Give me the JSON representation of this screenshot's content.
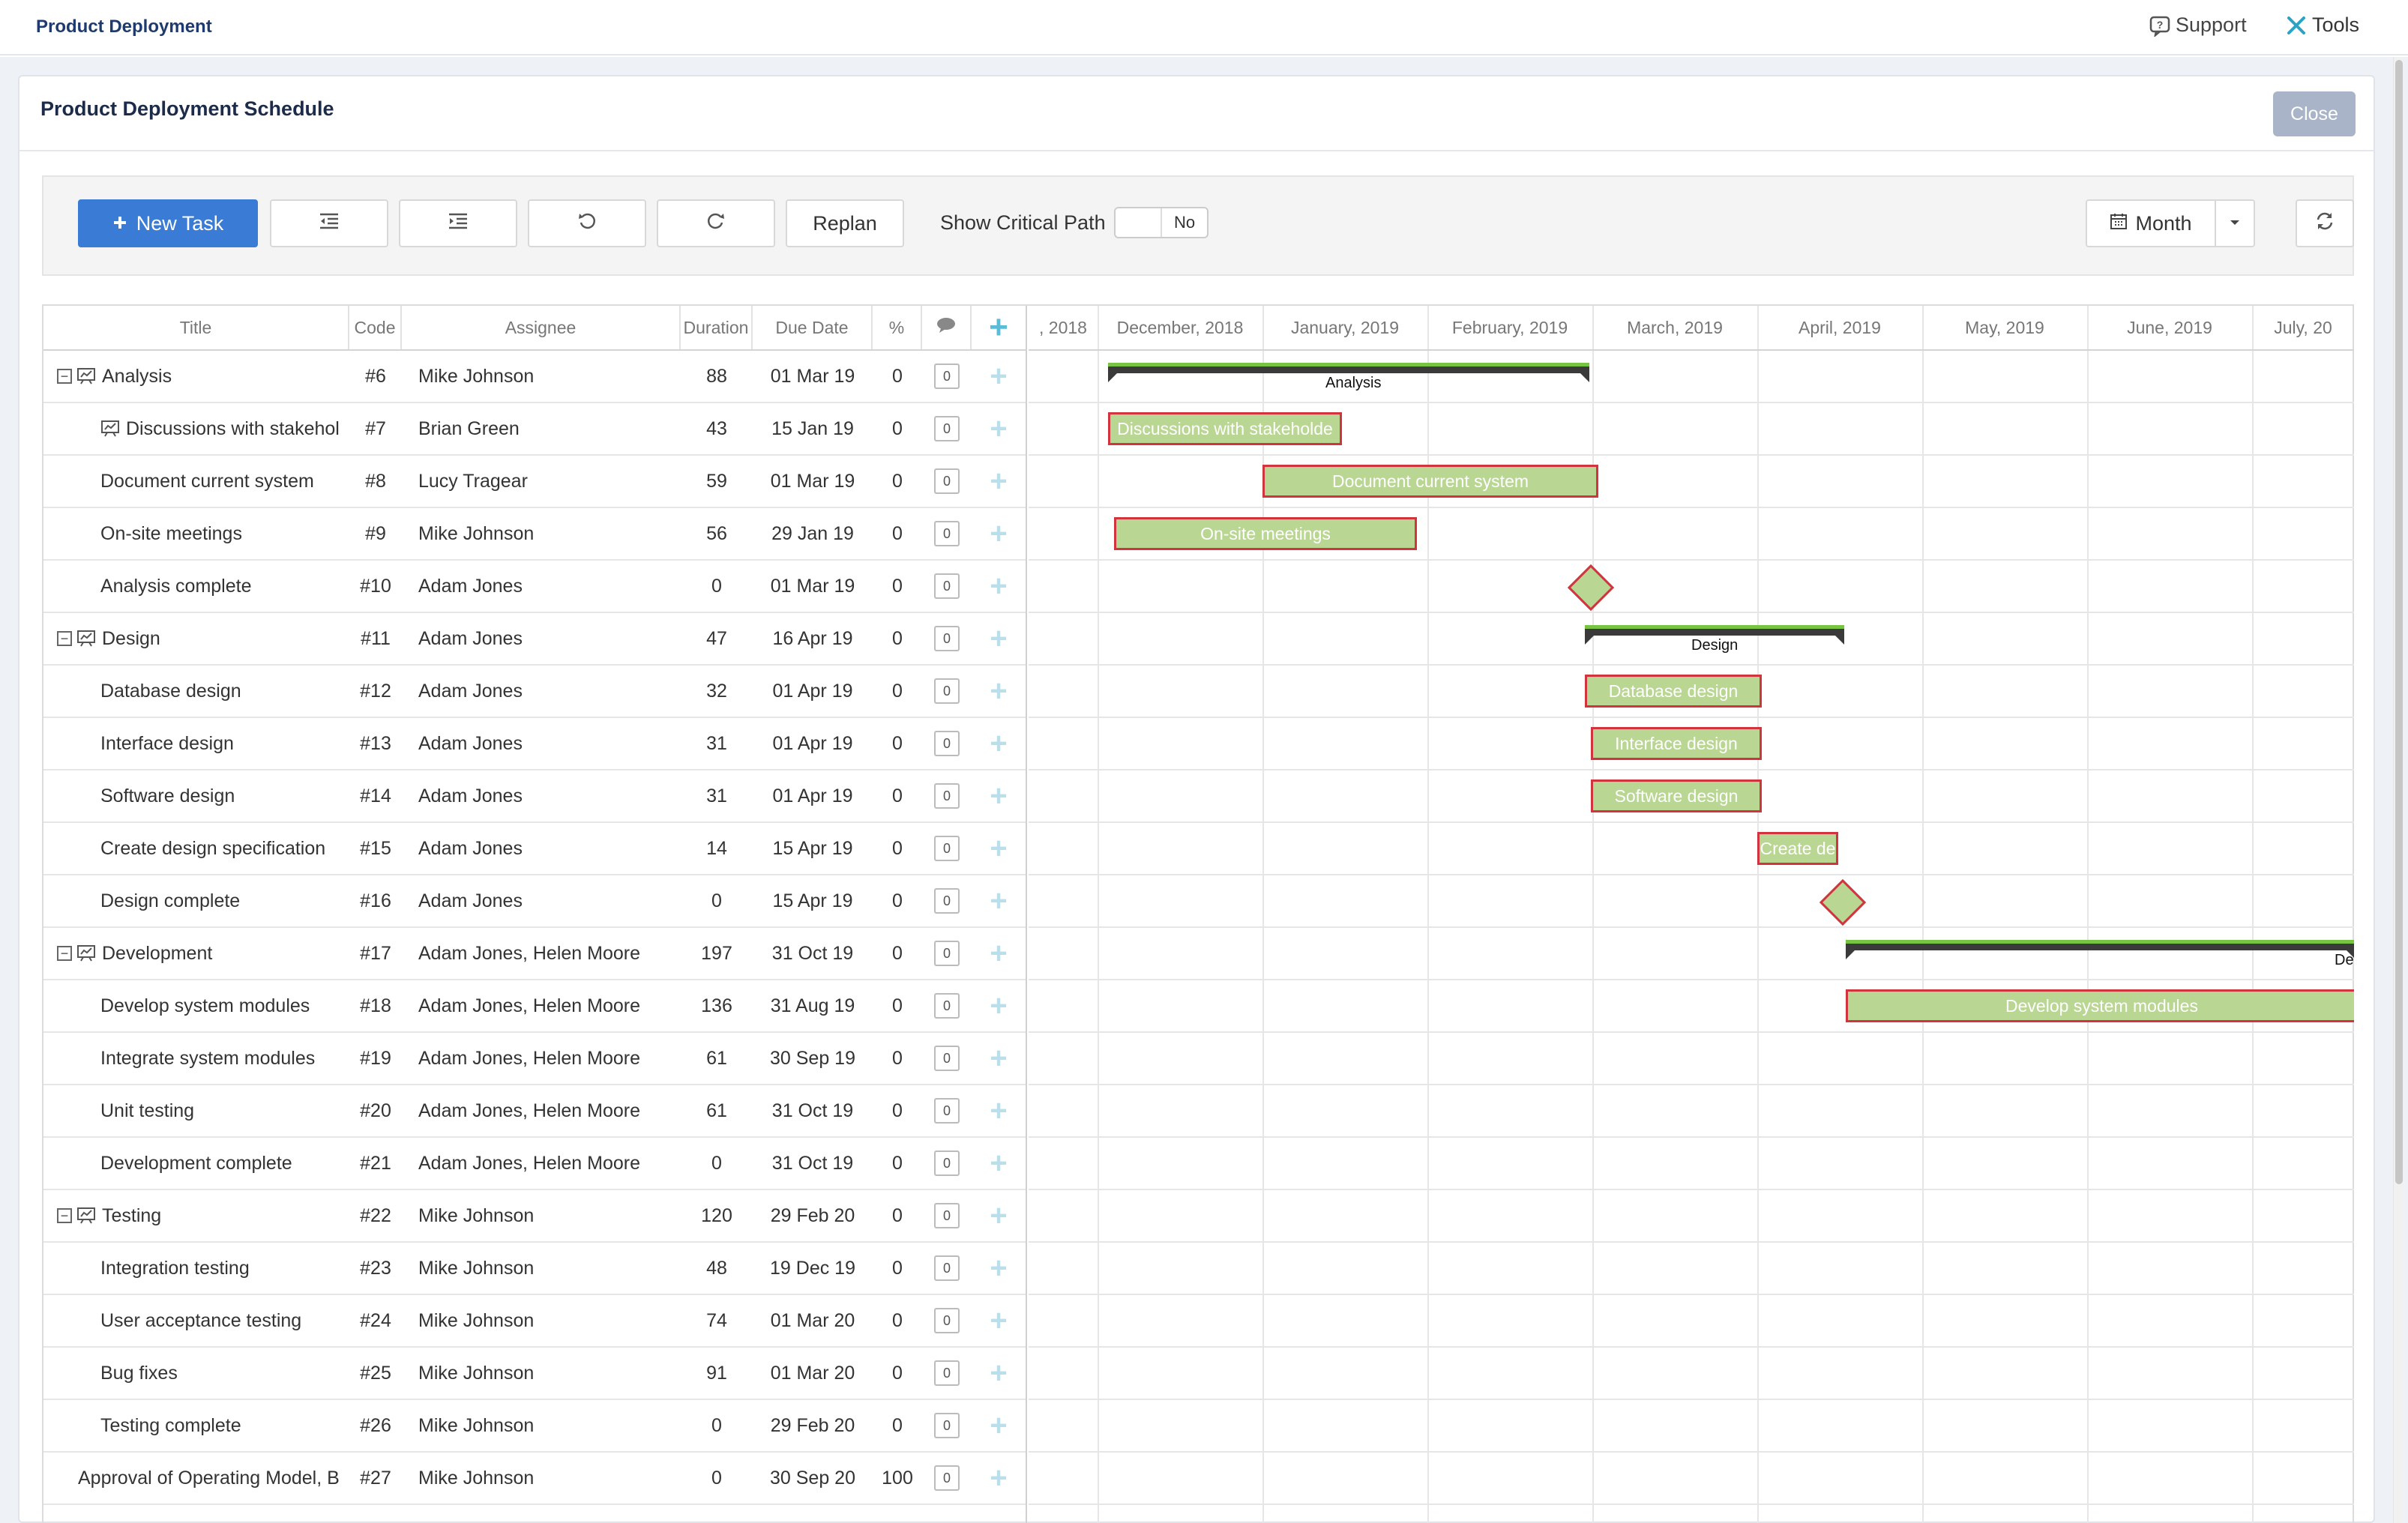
{
  "topbar": {
    "app_title": "Product Deployment",
    "support": "Support",
    "tools": "Tools"
  },
  "modal": {
    "title": "Product Deployment Schedule",
    "close": "Close"
  },
  "toolbar": {
    "new_task": "New Task",
    "replan": "Replan",
    "critical_path_label": "Show Critical Path",
    "critical_path_value": "No",
    "view_mode": "Month"
  },
  "columns": {
    "title": "Title",
    "code": "Code",
    "assignee": "Assignee",
    "duration": "Duration",
    "due_date": "Due Date",
    "percent": "%"
  },
  "timeline": {
    "months": [
      ", 2018",
      "December, 2018",
      "January, 2019",
      "February, 2019",
      "March, 2019",
      "April, 2019",
      "May, 2019",
      "June, 2019",
      "July, 20"
    ]
  },
  "tasks": [
    {
      "title": "Analysis",
      "code": "#6",
      "assignee": "Mike Johnson",
      "duration": "88",
      "due": "01 Mar 19",
      "pct": "0",
      "comments": "0",
      "group": true
    },
    {
      "title": "Discussions with stakehol",
      "code": "#7",
      "assignee": "Brian Green",
      "duration": "43",
      "due": "15 Jan 19",
      "pct": "0",
      "comments": "0"
    },
    {
      "title": "Document current system",
      "code": "#8",
      "assignee": "Lucy Tragear",
      "duration": "59",
      "due": "01 Mar 19",
      "pct": "0",
      "comments": "0"
    },
    {
      "title": "On-site meetings",
      "code": "#9",
      "assignee": "Mike Johnson",
      "duration": "56",
      "due": "29 Jan 19",
      "pct": "0",
      "comments": "0"
    },
    {
      "title": "Analysis complete",
      "code": "#10",
      "assignee": "Adam Jones",
      "duration": "0",
      "due": "01 Mar 19",
      "pct": "0",
      "comments": "0"
    },
    {
      "title": "Design",
      "code": "#11",
      "assignee": "Adam Jones",
      "duration": "47",
      "due": "16 Apr 19",
      "pct": "0",
      "comments": "0",
      "group": true
    },
    {
      "title": "Database design",
      "code": "#12",
      "assignee": "Adam Jones",
      "duration": "32",
      "due": "01 Apr 19",
      "pct": "0",
      "comments": "0"
    },
    {
      "title": "Interface design",
      "code": "#13",
      "assignee": "Adam Jones",
      "duration": "31",
      "due": "01 Apr 19",
      "pct": "0",
      "comments": "0"
    },
    {
      "title": "Software design",
      "code": "#14",
      "assignee": "Adam Jones",
      "duration": "31",
      "due": "01 Apr 19",
      "pct": "0",
      "comments": "0"
    },
    {
      "title": "Create design specification",
      "code": "#15",
      "assignee": "Adam Jones",
      "duration": "14",
      "due": "15 Apr 19",
      "pct": "0",
      "comments": "0"
    },
    {
      "title": "Design complete",
      "code": "#16",
      "assignee": "Adam Jones",
      "duration": "0",
      "due": "15 Apr 19",
      "pct": "0",
      "comments": "0"
    },
    {
      "title": "Development",
      "code": "#17",
      "assignee": "Adam Jones,  Helen Moore",
      "duration": "197",
      "due": "31 Oct 19",
      "pct": "0",
      "comments": "0",
      "group": true
    },
    {
      "title": "Develop system modules",
      "code": "#18",
      "assignee": "Adam Jones,  Helen Moore",
      "duration": "136",
      "due": "31 Aug 19",
      "pct": "0",
      "comments": "0"
    },
    {
      "title": "Integrate system modules",
      "code": "#19",
      "assignee": "Adam Jones,  Helen Moore",
      "duration": "61",
      "due": "30 Sep 19",
      "pct": "0",
      "comments": "0"
    },
    {
      "title": "Unit testing",
      "code": "#20",
      "assignee": "Adam Jones,  Helen Moore",
      "duration": "61",
      "due": "31 Oct 19",
      "pct": "0",
      "comments": "0"
    },
    {
      "title": "Development complete",
      "code": "#21",
      "assignee": "Adam Jones,  Helen Moore",
      "duration": "0",
      "due": "31 Oct 19",
      "pct": "0",
      "comments": "0"
    },
    {
      "title": "Testing",
      "code": "#22",
      "assignee": "Mike Johnson",
      "duration": "120",
      "due": "29 Feb 20",
      "pct": "0",
      "comments": "0",
      "group": true
    },
    {
      "title": "Integration testing",
      "code": "#23",
      "assignee": "Mike Johnson",
      "duration": "48",
      "due": "19 Dec 19",
      "pct": "0",
      "comments": "0"
    },
    {
      "title": "User acceptance testing",
      "code": "#24",
      "assignee": "Mike Johnson",
      "duration": "74",
      "due": "01 Mar 20",
      "pct": "0",
      "comments": "0"
    },
    {
      "title": "Bug fixes",
      "code": "#25",
      "assignee": "Mike Johnson",
      "duration": "91",
      "due": "01 Mar 20",
      "pct": "0",
      "comments": "0"
    },
    {
      "title": "Testing complete",
      "code": "#26",
      "assignee": "Mike Johnson",
      "duration": "0",
      "due": "29 Feb 20",
      "pct": "0",
      "comments": "0"
    },
    {
      "title": "Approval of Operating Model, B",
      "code": "#27",
      "assignee": "Mike Johnson",
      "duration": "0",
      "due": "30 Sep 20",
      "pct": "100",
      "comments": "0",
      "top": true
    }
  ],
  "gantt": {
    "summary_labels": {
      "analysis": "Analysis",
      "design": "Design",
      "development": "De"
    },
    "bar_labels": {
      "discussions": "Discussions with stakeholde",
      "document": "Document current system",
      "onsite": "On-site meetings",
      "database": "Database design",
      "interface": "Interface design",
      "software": "Software design",
      "create_spec": "Create de",
      "develop": "Develop system modules"
    }
  },
  "colors": {
    "primary": "#3a7bd5",
    "bar_fill": "#b9d692",
    "bar_border": "#d0353f",
    "summary": "#3a3a3a",
    "summary_accent": "#76c442"
  }
}
